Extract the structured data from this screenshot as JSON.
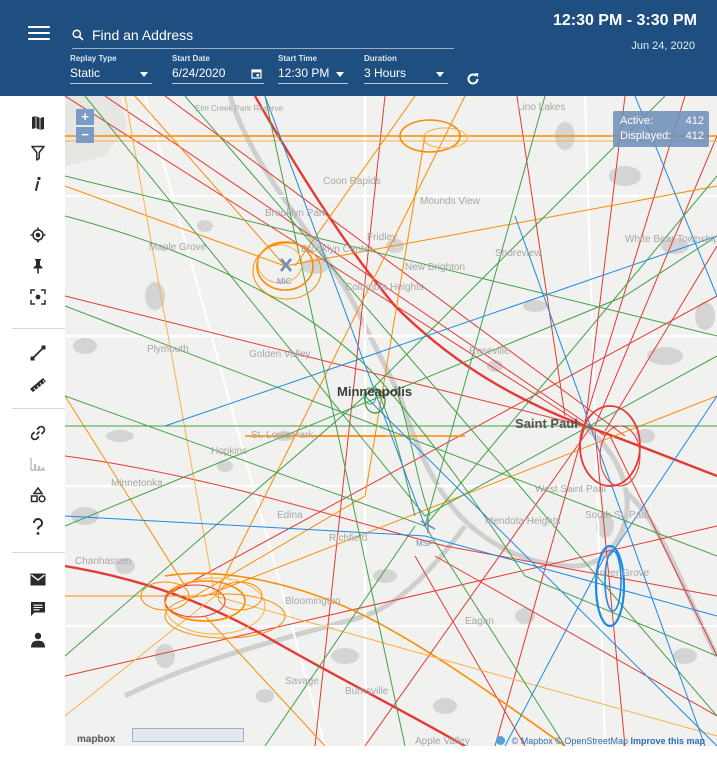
{
  "header": {
    "search_placeholder": "Find an Address",
    "replay_type": {
      "label": "Replay Type",
      "value": "Static"
    },
    "start_date": {
      "label": "Start Date",
      "value": "6/24/2020"
    },
    "start_time": {
      "label": "Start Time",
      "value": "12:30 PM"
    },
    "duration": {
      "label": "Duration",
      "value": "3 Hours"
    },
    "time_range": "12:30 PM - 3:30 PM",
    "date": "Jun 24, 2020"
  },
  "sidebar": {
    "icons": [
      "map-icon",
      "filter-icon",
      "info-icon",
      "locate-icon",
      "pin-icon",
      "focus-icon",
      "route-icon",
      "ruler-icon",
      "link-icon",
      "chart-icon",
      "shapes-icon",
      "help-icon",
      "mail-icon",
      "chat-icon",
      "user-icon"
    ]
  },
  "map": {
    "zoom_in": "+",
    "zoom_out": "−",
    "counts": {
      "active_label": "Active:",
      "active_value": "412",
      "displayed_label": "Displayed:",
      "displayed_value": "412"
    },
    "labels": {
      "minneapolis": "Minneapolis",
      "saint_paul": "Saint Paul",
      "coon_rapids": "Coon Rapids",
      "brooklyn_park": "Brooklyn Park",
      "brooklyn_center": "Brooklyn Center",
      "maple_grove": "Maple Grove",
      "fridley": "Fridley",
      "mounds_view": "Mounds View",
      "new_brighton": "New Brighton",
      "columbia_heights": "Columbia Heights",
      "shoreview": "Shoreview",
      "white_bear": "White Bear Township",
      "golden_valley": "Golden Valley",
      "plymouth": "Plymouth",
      "roseville": "Roseville",
      "st_louis_park": "St. Louis Park",
      "hopkins": "Hopkins",
      "minnetonka": "Minnetonka",
      "edina": "Edina",
      "richfield": "Richfield",
      "west_saint_paul": "West Saint Paul",
      "mendota_heights": "Mendota Heights",
      "south_st_paul": "South St. Paul",
      "inver_grove": "Inver Grove",
      "bloomington": "Bloomington",
      "eagan": "Eagan",
      "chanhassen": "Chanhassen",
      "burnsville": "Burnsville",
      "savage": "Savage",
      "apple_valley": "Apple Valley",
      "elm_creek": "Elm Creek Park Reserve",
      "lino_lakes": "Lino Lakes",
      "msp": "MSP",
      "mic": "MIC"
    },
    "mapbox_logo": "mapbox",
    "attribution": {
      "mapbox": "© Mapbox",
      "osm": "© OpenStreetMap",
      "improve": "Improve this map"
    }
  },
  "colors": {
    "header": "#1f4f80",
    "red": "#e53935",
    "orange": "#fb8c00",
    "green": "#43a047",
    "blue": "#1e88e5"
  }
}
